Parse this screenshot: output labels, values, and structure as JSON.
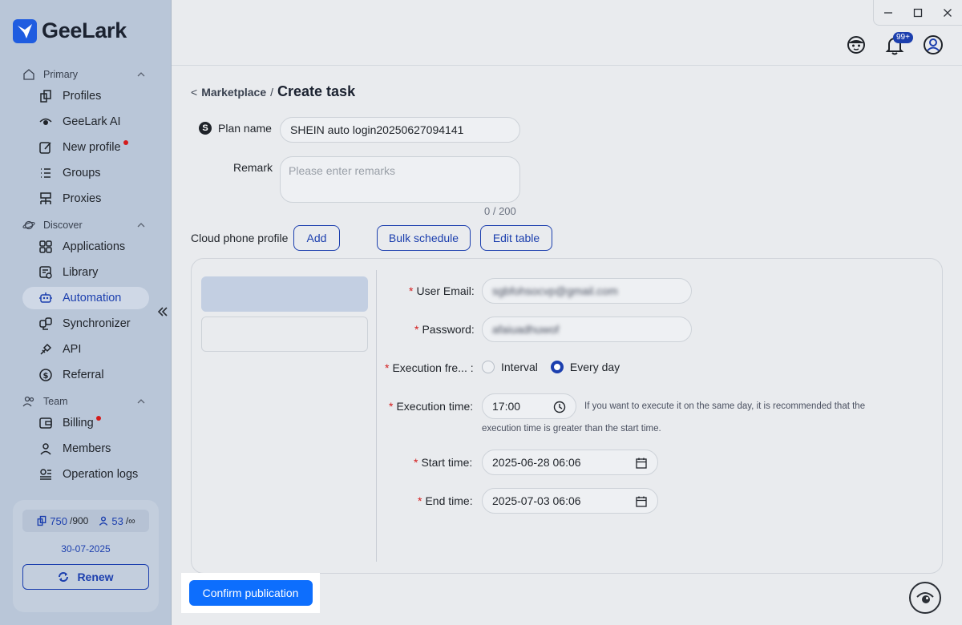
{
  "app": {
    "brand": "GeeLark"
  },
  "colors": {
    "accent": "#1c3fae",
    "primary_button": "#0d6efd",
    "sidebar_bg": "#b9c6d8",
    "required": "#d41b1b"
  },
  "sidebar": {
    "sections": [
      {
        "label": "Primary",
        "icon": "home-icon",
        "items": [
          {
            "label": "Profiles",
            "icon": "profiles-icon"
          },
          {
            "label": "GeeLark AI",
            "icon": "ai-eye-icon"
          },
          {
            "label": "New profile",
            "icon": "edit-icon",
            "dot": true
          },
          {
            "label": "Groups",
            "icon": "list-icon"
          },
          {
            "label": "Proxies",
            "icon": "network-icon"
          }
        ]
      },
      {
        "label": "Discover",
        "icon": "planet-icon",
        "items": [
          {
            "label": "Applications",
            "icon": "grid-icon"
          },
          {
            "label": "Library",
            "icon": "library-icon"
          },
          {
            "label": "Automation",
            "icon": "robot-icon",
            "active": true
          },
          {
            "label": "Synchronizer",
            "icon": "sync-icon"
          },
          {
            "label": "API",
            "icon": "api-icon"
          },
          {
            "label": "Referral",
            "icon": "dollar-icon"
          }
        ]
      },
      {
        "label": "Team",
        "icon": "team-icon",
        "items": [
          {
            "label": "Billing",
            "icon": "wallet-icon",
            "dot": true
          },
          {
            "label": "Members",
            "icon": "user-icon"
          },
          {
            "label": "Operation logs",
            "icon": "logs-icon"
          }
        ]
      }
    ],
    "quota": {
      "profiles_used": "750",
      "profiles_total": "/900",
      "members_used": "53",
      "members_total": "/∞",
      "expiry": "30-07-2025",
      "renew_label": "Renew"
    }
  },
  "topbar": {
    "notification_badge": "99+"
  },
  "breadcrumb": {
    "back": "<",
    "parent": "Marketplace",
    "separator": "/",
    "current": "Create task"
  },
  "form": {
    "plan_name_icon": "S",
    "plan_name_label": "Plan name",
    "plan_name_value": "SHEIN auto login20250627094141",
    "remark_label": "Remark",
    "remark_placeholder": "Please enter remarks",
    "remark_counter": "0 / 200",
    "cloud_phone_label": "Cloud phone profile",
    "add_label": "Add",
    "bulk_schedule_label": "Bulk schedule",
    "edit_table_label": "Edit table"
  },
  "task_fields": {
    "user_email_label": "User Email",
    "user_email_value": "sgbfohsocvp@gmail.com",
    "password_label": "Password",
    "password_value": "afaiuadhuwof",
    "exec_freq_label": "Execution fre...",
    "interval_label": "Interval",
    "every_day_label": "Every day",
    "selected_freq": "Every day",
    "exec_time_label": "Execution time",
    "exec_time_value": "17:00",
    "exec_time_hint_1": "If you want to execute it on the same day, it is recommended that the",
    "exec_time_hint_2": "execution time is greater than the start time.",
    "start_time_label": "Start time",
    "start_time_value": "2025-06-28 06:06",
    "end_time_label": "End time",
    "end_time_value": "2025-07-03 06:06",
    "colon": ":",
    "required_mark": "*"
  },
  "footer": {
    "confirm_label": "Confirm publication"
  }
}
